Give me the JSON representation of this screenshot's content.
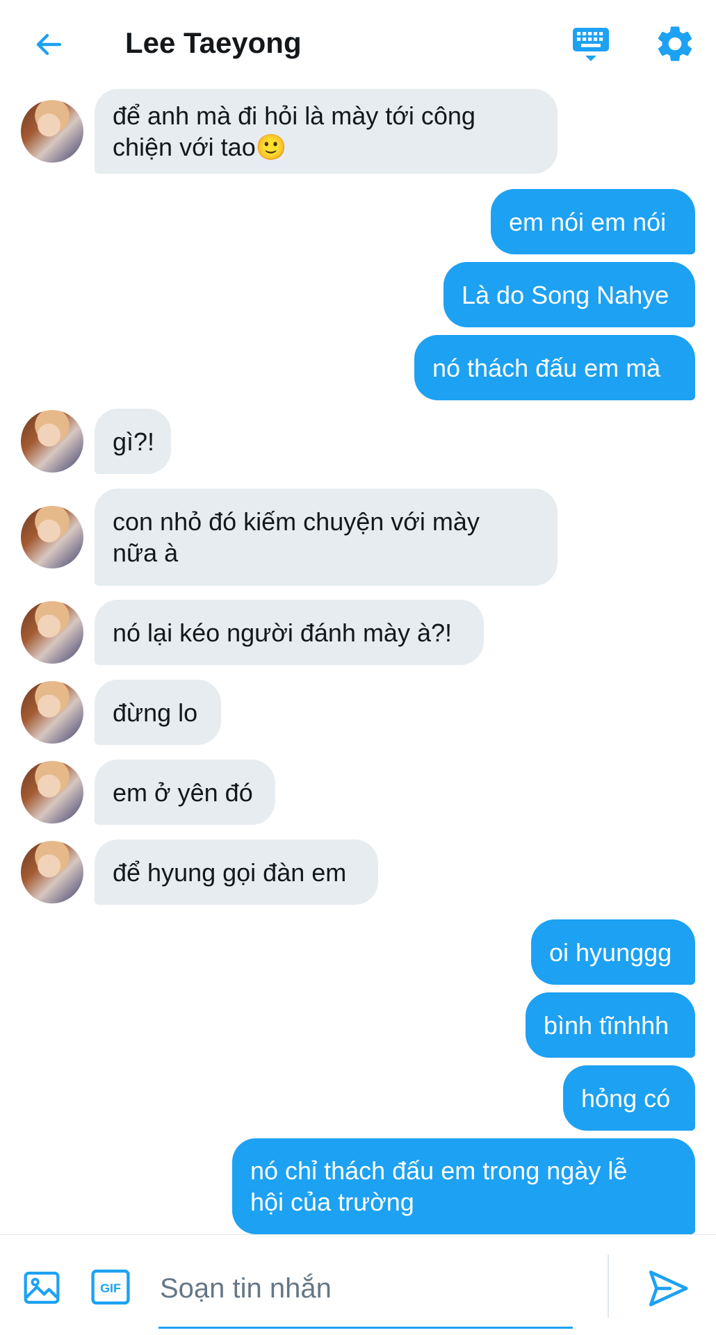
{
  "header": {
    "title": "Lee Taeyong",
    "back_icon": "arrow-left-icon",
    "keyboard_icon": "keyboard-icon",
    "settings_icon": "gear-icon"
  },
  "messages": [
    {
      "side": "in",
      "lines": [
        "để anh mà đi hỏi là mày tới công",
        "chiện với tao🙂"
      ]
    },
    {
      "side": "out",
      "lines": [
        "em nói em nói"
      ]
    },
    {
      "side": "out",
      "lines": [
        "Là do Song Nahye"
      ]
    },
    {
      "side": "out",
      "lines": [
        "nó thách đấu em mà"
      ]
    },
    {
      "side": "in",
      "lines": [
        "gì?!"
      ]
    },
    {
      "side": "in",
      "lines": [
        "con nhỏ đó kiếm chuyện với mày",
        "nữa à"
      ]
    },
    {
      "side": "in",
      "lines": [
        "nó lại kéo người đánh mày à?!"
      ]
    },
    {
      "side": "in",
      "lines": [
        "đừng lo"
      ]
    },
    {
      "side": "in",
      "lines": [
        "em ở yên đó"
      ]
    },
    {
      "side": "in",
      "lines": [
        "để hyung gọi đàn em"
      ]
    },
    {
      "side": "out",
      "lines": [
        "oi hyunggg"
      ]
    },
    {
      "side": "out",
      "lines": [
        "bình tĩnhhh"
      ]
    },
    {
      "side": "out",
      "lines": [
        "hỏng có"
      ]
    },
    {
      "side": "out",
      "lines": [
        "nó chỉ thách đấu em trong ngày lễ",
        "hội của trường"
      ]
    }
  ],
  "composer": {
    "placeholder": "Soạn tin nhắn",
    "gif_label": "GIF",
    "image_icon": "image-icon",
    "send_icon": "send-icon"
  },
  "colors": {
    "accent": "#1da1f2",
    "incoming_bubble": "#e6ecf0",
    "text": "#14171a",
    "placeholder": "#657786"
  }
}
